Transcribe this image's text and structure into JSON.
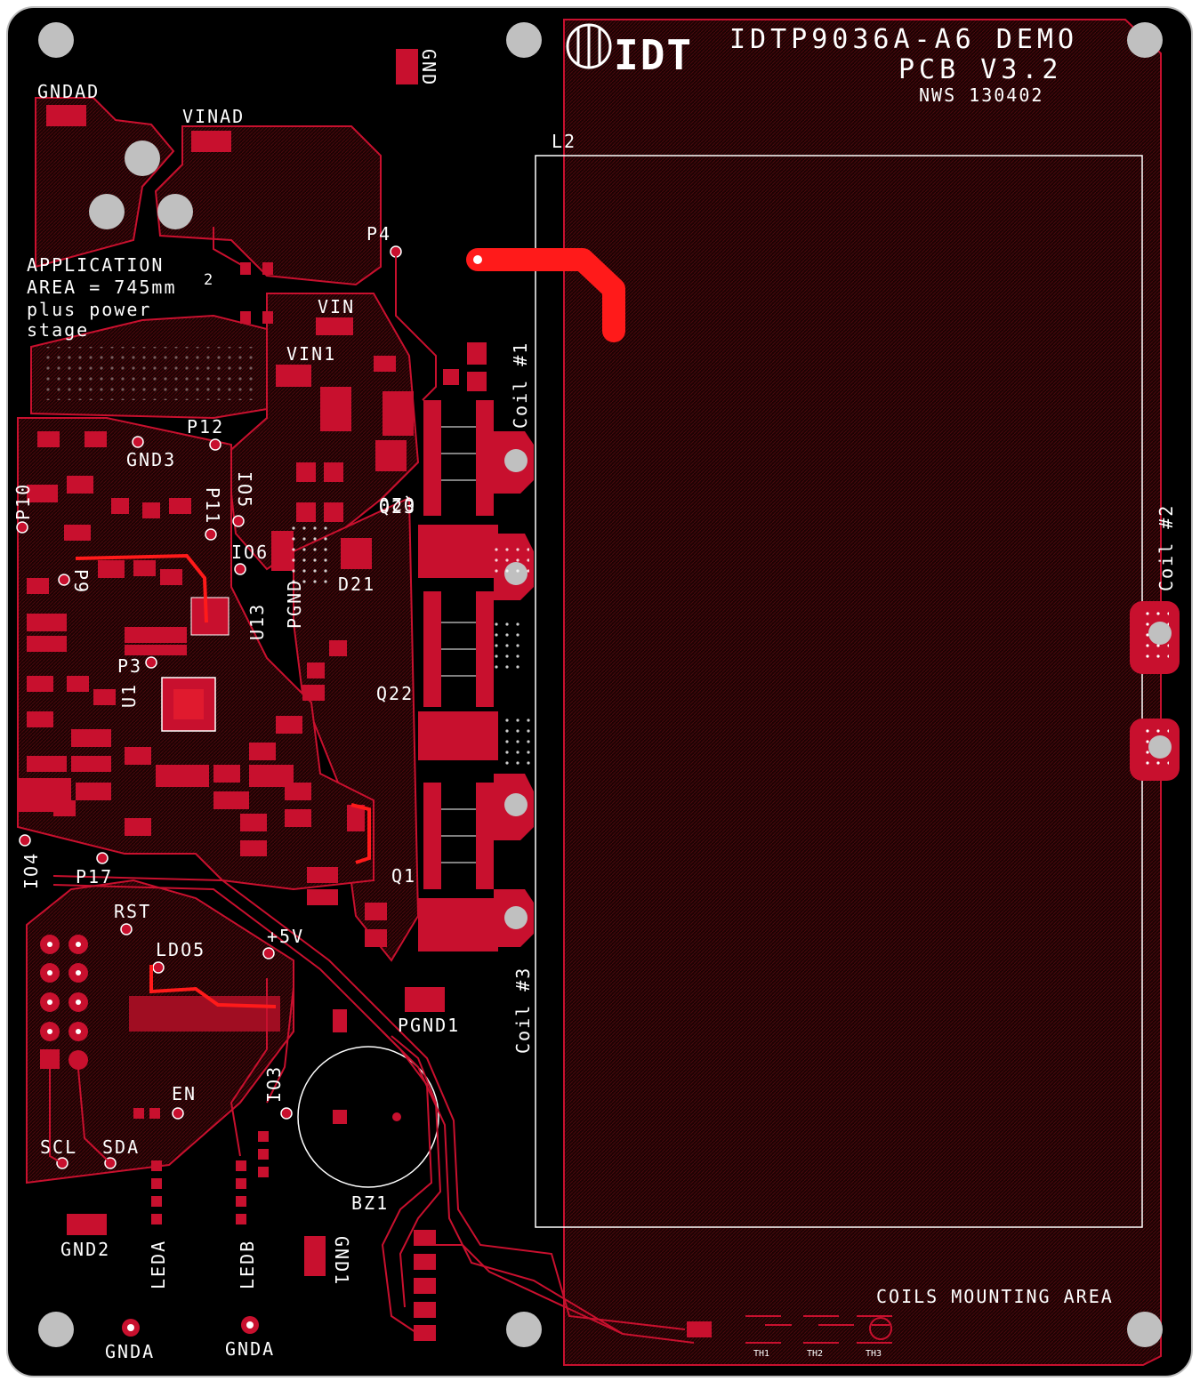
{
  "colors": {
    "board": "#000000",
    "copper": "#c8102e",
    "copper_pour": "#3a0608",
    "trace_bright": "#ff1a1a",
    "silkscreen": "#ffffff",
    "hole": "#c0c0c0"
  },
  "title": {
    "line1": "IDTP9036A-A6 DEMO",
    "line2": "PCB V3.2",
    "line3": "NWS 130402",
    "logo_text": "IDT"
  },
  "labels": {
    "gnd_top": "GND",
    "gndad": "GNDAD",
    "vinad": "VINAD",
    "p4": "P4",
    "l2": "L2",
    "app_area_1": "APPLICATION",
    "app_area_2": "AREA = 745mm",
    "app_area_sup": "2",
    "app_area_3": "plus power",
    "app_area_4": "stage",
    "vin": "VIN",
    "vin1": "VIN1",
    "coil1": "Coil #1",
    "coil2": "Coil #2",
    "coil3": "Coil #3",
    "p12": "P12",
    "gnd3": "GND3",
    "p10": "P10",
    "io5": "IO5",
    "p11": "P11",
    "q20": "Q20",
    "q23": "Q23",
    "io6": "IO6",
    "pgnd": "PGND",
    "d21": "D21",
    "p9": "P9",
    "u13": "U13",
    "p3": "P3",
    "u1": "U1",
    "q22": "Q22",
    "io4": "IO4",
    "p17": "P17",
    "q1": "Q1",
    "rst": "RST",
    "ldo5": "LDO5",
    "plus5v": "+5V",
    "pgnd1": "PGND1",
    "en": "EN",
    "io3": "IO3",
    "bz1": "BZ1",
    "scl": "SCL",
    "sda": "SDA",
    "gnd2": "GND2",
    "leda": "LEDA",
    "ledb": "LEDB",
    "gnd1": "GND1",
    "gnda_left": "GNDA",
    "gnda_right": "GNDA",
    "coils_area": "COILS MOUNTING AREA",
    "th1": "TH1",
    "th2": "TH2",
    "th3": "TH3"
  }
}
